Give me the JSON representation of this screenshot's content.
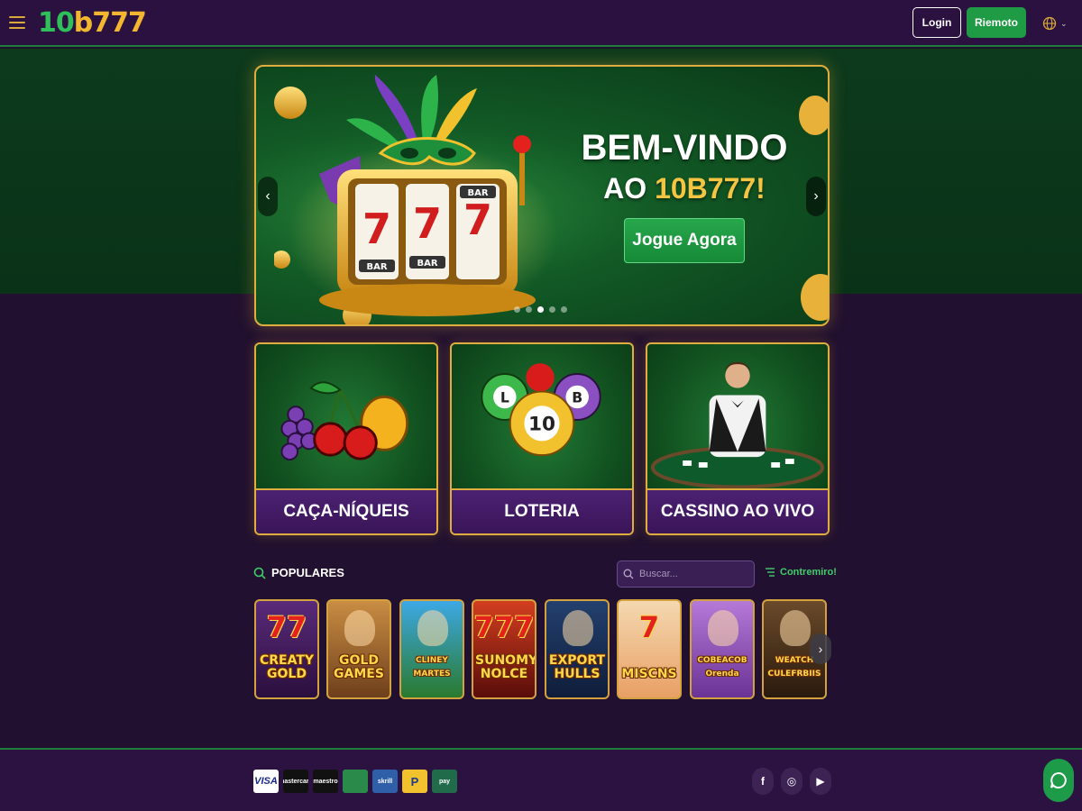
{
  "header": {
    "logo_part1": "10",
    "logo_part2": "b777",
    "login_label": "Login",
    "register_label": "Riemoto",
    "language_icon": "globe-icon"
  },
  "banner": {
    "title": "BEM-VINDO",
    "subtitle_prefix": "AO ",
    "subtitle_brand": "10B777!",
    "cta_label": "Jogue Agora",
    "slide_count": 5,
    "active_slide": 3,
    "slot_symbols": [
      "7",
      "7",
      "7"
    ],
    "slot_bar_labels": [
      "BAR",
      "BAR",
      "BAR"
    ]
  },
  "categories": [
    {
      "label": "CAÇA-NÍQUEIS",
      "icon": "fruits-icon"
    },
    {
      "label": "LOTERIA",
      "icon": "lottery-balls-icon",
      "ball_labels": [
        "L",
        "10",
        "B"
      ]
    },
    {
      "label": "CASSINO AO VIVO",
      "icon": "live-dealer-icon"
    }
  ],
  "populares": {
    "title": "POPULARES",
    "search_placeholder": "Buscar...",
    "filter_label": "Contremiro!",
    "games": [
      {
        "name": "CREATY GOLD",
        "top": "77",
        "bg1": "#5a2a7a",
        "bg2": "#2a0f3e"
      },
      {
        "name": "GOLD GAMES",
        "bg1": "#c98d43",
        "bg2": "#6e3f1c"
      },
      {
        "name": "CLINEY MARTES",
        "bg1": "#3da8e4",
        "bg2": "#2a7a2e"
      },
      {
        "name": "SUNOMY NOLCE",
        "top": "777",
        "bg1": "#d33e1f",
        "bg2": "#5a0d0a"
      },
      {
        "name": "EXPORT HULLS",
        "bg1": "#23406e",
        "bg2": "#0f1d3a"
      },
      {
        "name": "MISCNS",
        "top": "7",
        "bg1": "#f4d8b0",
        "bg2": "#e8a065"
      },
      {
        "name": "COBEACOB Orenda",
        "bg1": "#b57ad8",
        "bg2": "#6b3396"
      },
      {
        "name": "WEATCH CULEFRBIIS",
        "bg1": "#6a4a2a",
        "bg2": "#2a1a0e"
      }
    ]
  },
  "footer": {
    "payments": [
      {
        "name": "VISA",
        "bg": "#ffffff",
        "fg": "#1a2a8c"
      },
      {
        "name": "mastercard",
        "bg": "#111111",
        "fg": "#ffffff"
      },
      {
        "name": "maestro",
        "bg": "#111111",
        "fg": "#ffffff"
      },
      {
        "name": "",
        "bg": "#2a8a4a",
        "fg": "#ffffff"
      },
      {
        "name": "skrill",
        "bg": "#2f5fa8",
        "fg": "#ffffff"
      },
      {
        "name": "P",
        "bg": "#f2c12e",
        "fg": "#1a3c8a"
      },
      {
        "name": "pay",
        "bg": "#1f6b4a",
        "fg": "#ffffff"
      }
    ],
    "socials": [
      "f",
      "◎",
      "▶"
    ]
  }
}
